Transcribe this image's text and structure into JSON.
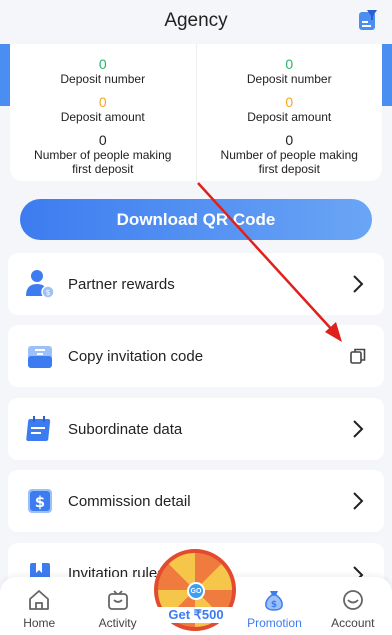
{
  "header": {
    "title": "Agency"
  },
  "stats": {
    "left": {
      "deposit_number_value": "0",
      "deposit_number_label": "Deposit number",
      "deposit_amount_value": "0",
      "deposit_amount_label": "Deposit amount",
      "first_deposit_value": "0",
      "first_deposit_label": "Number of people making first deposit"
    },
    "right": {
      "deposit_number_value": "0",
      "deposit_number_label": "Deposit number",
      "deposit_amount_value": "0",
      "deposit_amount_label": "Deposit amount",
      "first_deposit_value": "0",
      "first_deposit_label": "Number of people making first deposit"
    }
  },
  "qr_button": {
    "label": "Download QR Code"
  },
  "menu": {
    "partner_rewards": "Partner rewards",
    "copy_invitation": "Copy invitation code",
    "subordinate_data": "Subordinate data",
    "commission_detail": "Commission detail",
    "invitation_rules": "Invitation rules"
  },
  "tabbar": {
    "home": "Home",
    "activity": "Activity",
    "center": "Get ₹500",
    "promotion": "Promotion",
    "account": "Account"
  },
  "wheel_badge": "GO",
  "colors": {
    "accent": "#3d7cf0",
    "green": "#27b36b",
    "orange": "#f5a623",
    "annotation_arrow": "#e0201b"
  }
}
